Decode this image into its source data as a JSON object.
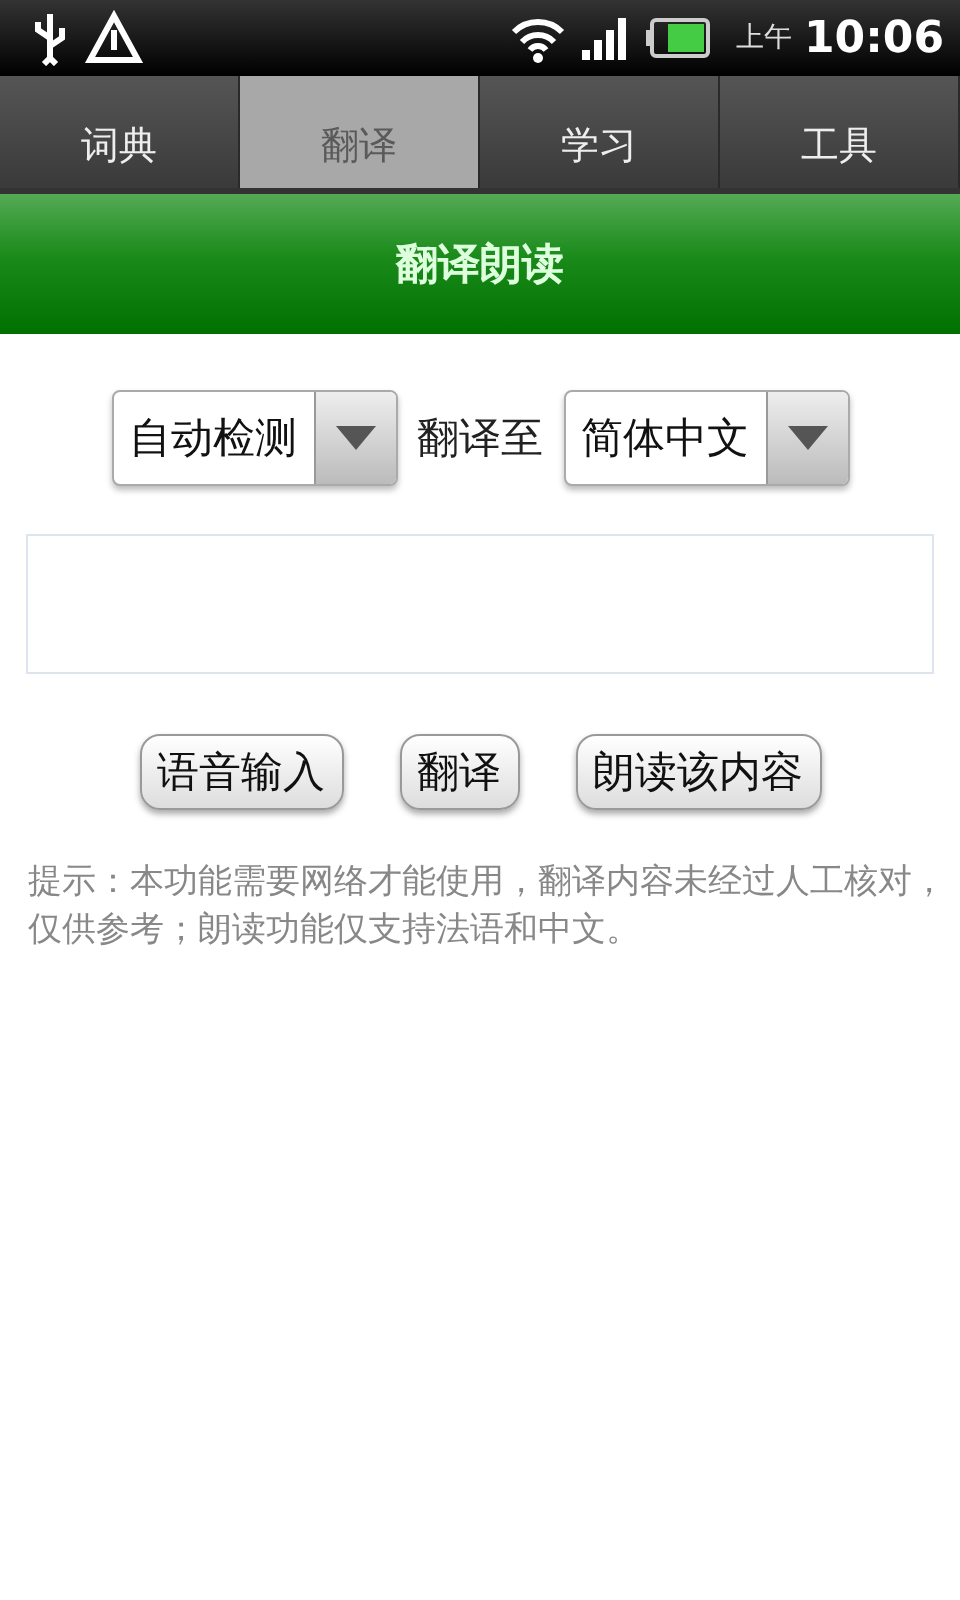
{
  "status_bar": {
    "am_pm": "上午",
    "time": "10:06"
  },
  "tabs": [
    {
      "label": "词典",
      "selected": false
    },
    {
      "label": "翻译",
      "selected": true
    },
    {
      "label": "学习",
      "selected": false
    },
    {
      "label": "工具",
      "selected": false
    }
  ],
  "header": {
    "title": "翻译朗读"
  },
  "language": {
    "source": "自动检测",
    "connector": "翻译至",
    "target": "简体中文"
  },
  "buttons": [
    "语音输入",
    "翻译",
    "朗读该内容"
  ],
  "hint": "提示：本功能需要网络才能使用，翻译内容未经过人工核对，仅供参考；朗读功能仅支持法语和中文。"
}
